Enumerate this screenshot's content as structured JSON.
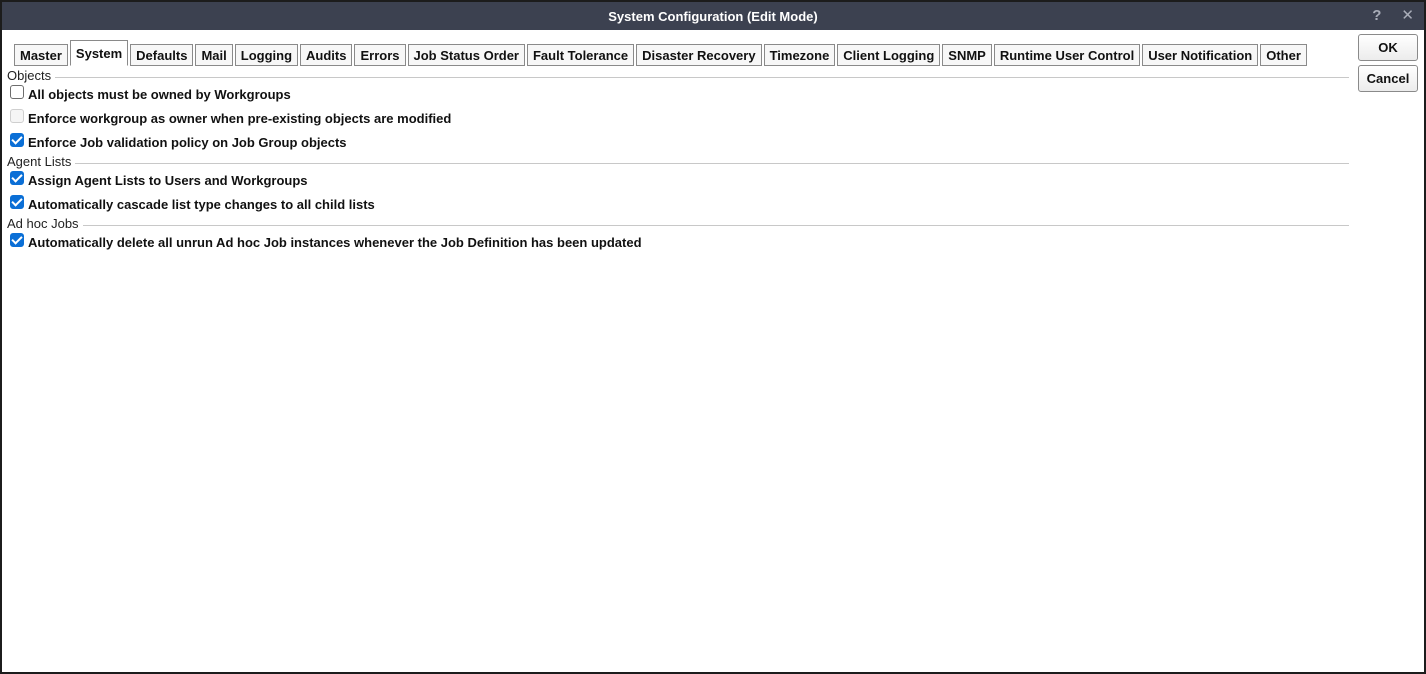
{
  "window": {
    "title": "System Configuration (Edit Mode)",
    "help_icon": "?",
    "close_icon": "✕"
  },
  "tabs": [
    {
      "label": "Master",
      "active": false
    },
    {
      "label": "System",
      "active": true
    },
    {
      "label": "Defaults",
      "active": false
    },
    {
      "label": "Mail",
      "active": false
    },
    {
      "label": "Logging",
      "active": false
    },
    {
      "label": "Audits",
      "active": false
    },
    {
      "label": "Errors",
      "active": false
    },
    {
      "label": "Job Status Order",
      "active": false
    },
    {
      "label": "Fault Tolerance",
      "active": false
    },
    {
      "label": "Disaster Recovery",
      "active": false
    },
    {
      "label": "Timezone",
      "active": false
    },
    {
      "label": "Client Logging",
      "active": false
    },
    {
      "label": "SNMP",
      "active": false
    },
    {
      "label": "Runtime User Control",
      "active": false
    },
    {
      "label": "User Notification",
      "active": false
    },
    {
      "label": "Other",
      "active": false
    }
  ],
  "groups": {
    "objects": {
      "title": "Objects",
      "options": [
        {
          "label": "All objects must be owned by Workgroups",
          "checked": false,
          "disabled": false
        },
        {
          "label": "Enforce workgroup as owner when pre-existing objects are modified",
          "checked": false,
          "disabled": true
        },
        {
          "label": "Enforce Job validation policy on Job Group objects",
          "checked": true,
          "disabled": false
        }
      ]
    },
    "agent_lists": {
      "title": "Agent Lists",
      "options": [
        {
          "label": "Assign Agent Lists to Users and Workgroups",
          "checked": true,
          "disabled": false
        },
        {
          "label": "Automatically cascade list type changes to all child lists",
          "checked": true,
          "disabled": false
        }
      ]
    },
    "adhoc_jobs": {
      "title": "Ad hoc Jobs",
      "options": [
        {
          "label": "Automatically delete all unrun Ad hoc Job instances whenever the Job Definition has been updated",
          "checked": true,
          "disabled": false
        }
      ]
    }
  },
  "buttons": {
    "ok": "OK",
    "cancel": "Cancel"
  },
  "colors": {
    "titlebar": "#3c4150",
    "checkbox_checked": "#0b6fd6"
  }
}
